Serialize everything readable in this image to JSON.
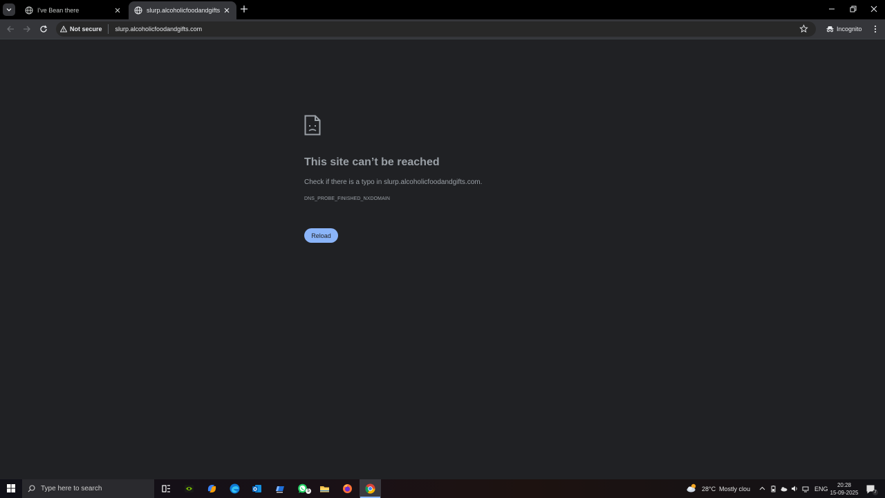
{
  "browser": {
    "tabs": [
      {
        "title": "I've Bean there",
        "active": false
      },
      {
        "title": "slurp.alcoholicfoodandgifts.com",
        "active": true
      }
    ],
    "address": {
      "security_label": "Not secure",
      "url": "slurp.alcoholicfoodandgifts.com"
    },
    "profile_label": "Incognito"
  },
  "error_page": {
    "title": "This site can’t be reached",
    "description_prefix": "Check if there is a typo in ",
    "description_host": "slurp.alcoholicfoodandgifts.com",
    "description_suffix": ".",
    "error_code": "DNS_PROBE_FINISHED_NXDOMAIN",
    "reload_label": "Reload"
  },
  "taskbar": {
    "search_placeholder": "Type here to search",
    "weather_temp": "28°C",
    "weather_text": "Mostly clou",
    "language": "ENG",
    "time": "20:28",
    "date": "15-09-2025",
    "whatsapp_badge": "5",
    "notification_count": "7",
    "colors": {
      "chrome_active": "#8ab4f8",
      "nvidia": "#76b900",
      "firefox": "#ff7139",
      "whatsapp": "#25d366"
    }
  }
}
